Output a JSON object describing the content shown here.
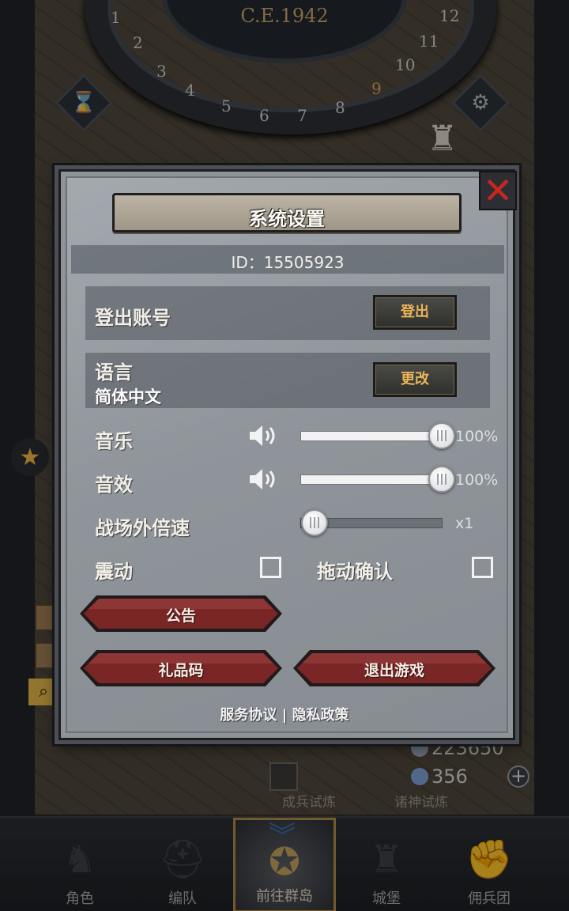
{
  "scene": {
    "year": "C.E.1942",
    "dial_numbers": [
      "1",
      "2",
      "3",
      "4",
      "5",
      "6",
      "7",
      "8",
      "9",
      "10",
      "11",
      "12"
    ],
    "resource_1": "223650",
    "resource_2": "356",
    "plus_label": "+",
    "trial_left": "成兵试炼",
    "trial_right": "诸神试炼"
  },
  "bottom_nav": {
    "items": [
      {
        "label": "角色",
        "icon": "knight-icon"
      },
      {
        "label": "编队",
        "icon": "helmet-icon"
      },
      {
        "label": "前往群岛",
        "icon": "compass-dragon-icon",
        "active": true
      },
      {
        "label": "城堡",
        "icon": "castle-icon"
      },
      {
        "label": "佣兵团",
        "icon": "fist-icon"
      }
    ]
  },
  "dialog": {
    "title": "系统设置",
    "id_text": "ID：15505923",
    "logout": {
      "label": "登出账号",
      "button": "登出"
    },
    "language": {
      "label": "语言",
      "current": "简体中文",
      "button": "更改"
    },
    "music": {
      "label": "音乐",
      "value_text": "100%",
      "level": 1.0
    },
    "sfx": {
      "label": "音效",
      "value_text": "100%",
      "level": 1.0
    },
    "battle_speed": {
      "label": "战场外倍速",
      "value_text": "x1",
      "level": 0.0
    },
    "vibration": {
      "label": "震动",
      "checked": false
    },
    "drag_confirm": {
      "label": "拖动确认",
      "checked": false
    },
    "notice_button": "公告",
    "gift_code_button": "礼品码",
    "quit_button": "退出游戏",
    "footer": {
      "terms": "服务协议",
      "separator": "|",
      "privacy": "隐私政策"
    }
  },
  "colors": {
    "accent_gold": "#e8b55a",
    "close_red": "#c8261f",
    "button_red": "#7a2626",
    "panel_gray": "#959ba0"
  }
}
